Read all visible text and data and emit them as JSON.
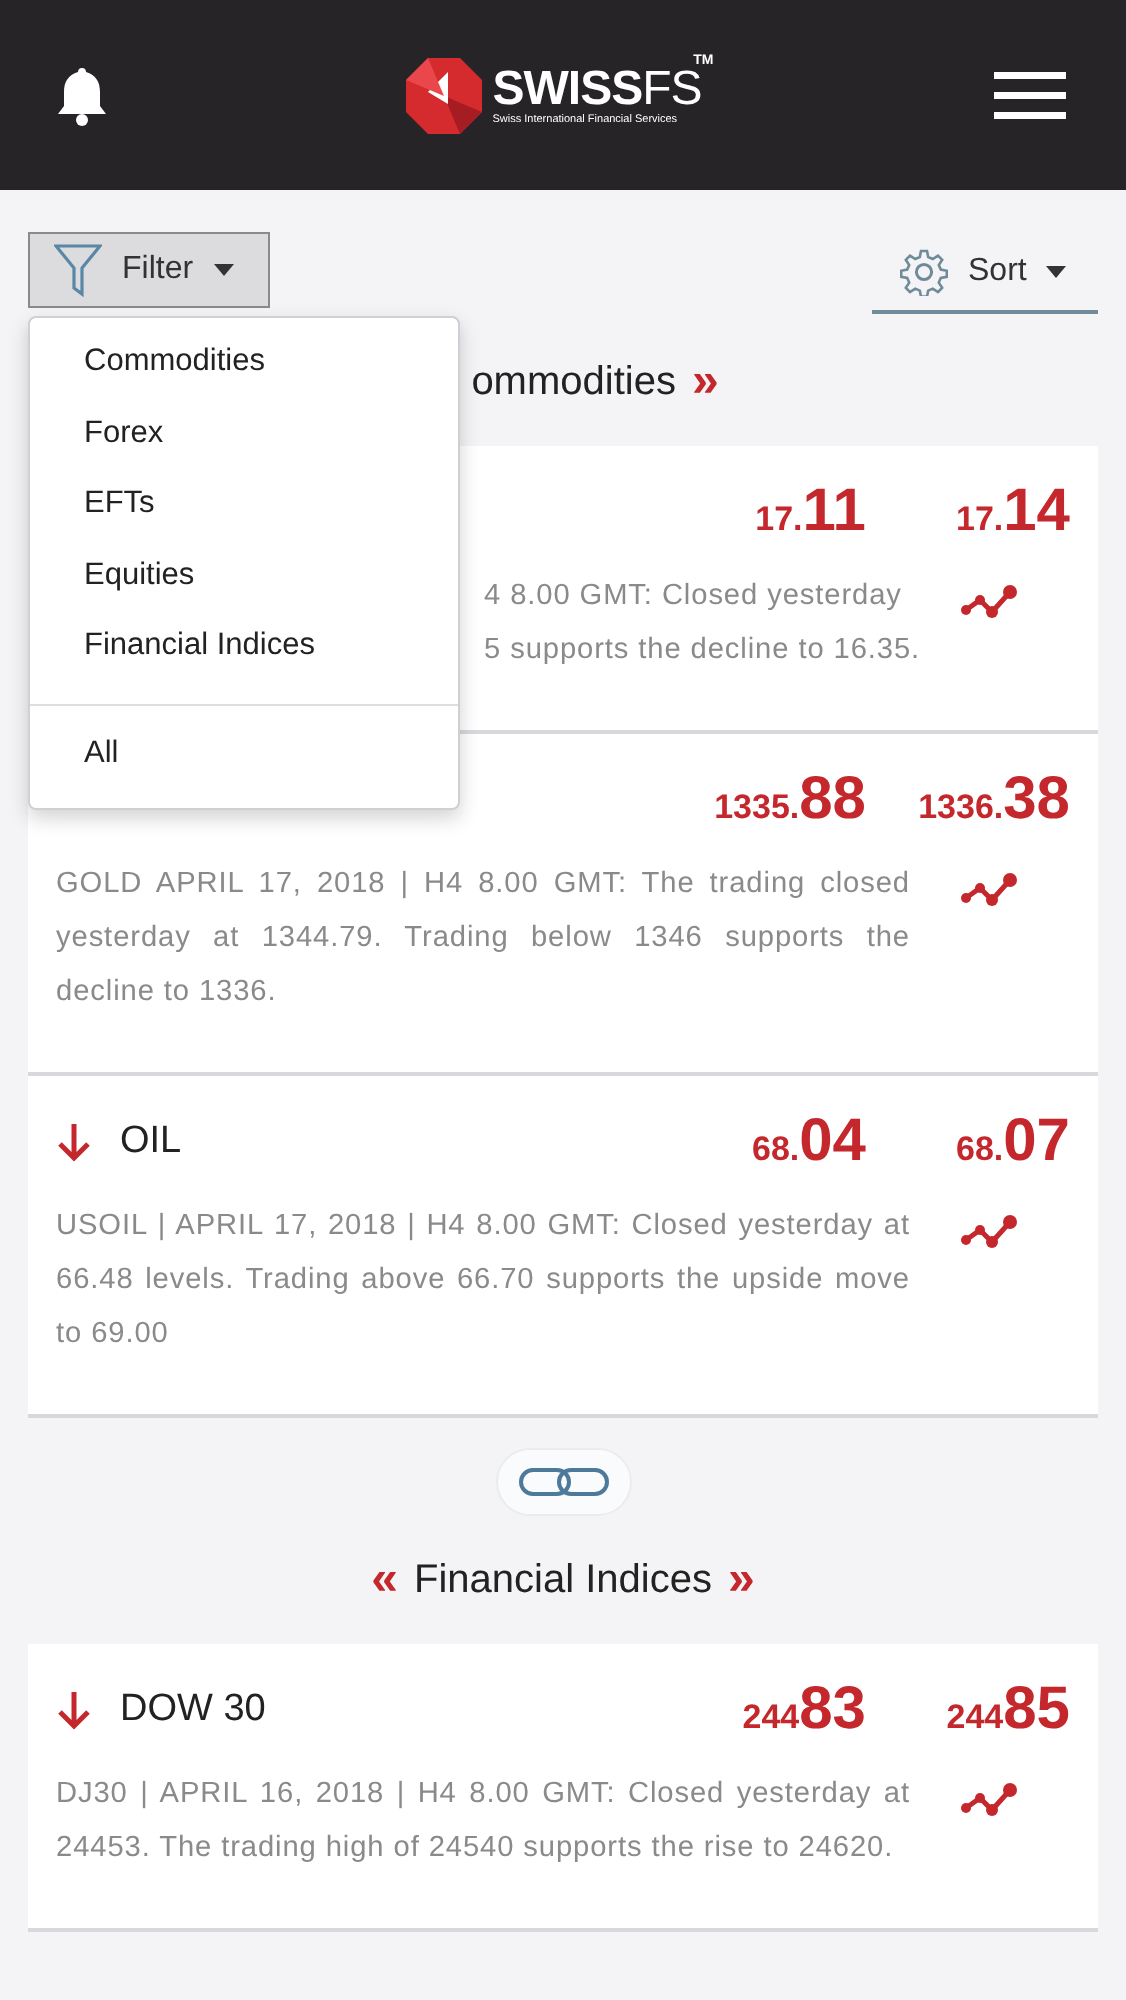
{
  "header": {
    "logo_text": "SWISS",
    "logo_text_2": "FS",
    "logo_tm": "TM",
    "logo_tagline": "Swiss International Financial Services"
  },
  "filter": {
    "label": "Filter",
    "expanded": true,
    "menu_groups": [
      [
        "Commodities",
        "Forex",
        "EFTs",
        "Equities",
        "Financial Indices"
      ],
      [
        "All"
      ]
    ]
  },
  "sort": {
    "label": "Sort"
  },
  "sections": [
    {
      "title": "ommodities",
      "right_marker": "»",
      "cards": [
        {
          "kind": "covered",
          "bid": {
            "int": "17.",
            "dec": "11"
          },
          "ask": {
            "int": "17.",
            "dec": "14"
          },
          "description_lines": [
            "4 8.00 GMT: Closed yesterday",
            "5 supports the decline to 16.35."
          ]
        },
        {
          "kind": "full",
          "bid": {
            "int": "1335.",
            "dec": "88"
          },
          "ask": {
            "int": "1336.",
            "dec": "38"
          },
          "description": "GOLD APRIL 17, 2018 | H4 8.00 GMT: The trading closed yesterday at 1344.79. Trading below 1346 supports the decline to 1336."
        },
        {
          "kind": "full",
          "falling": true,
          "name": "OIL",
          "bid": {
            "int": "68.",
            "dec": "04"
          },
          "ask": {
            "int": "68.",
            "dec": "07"
          },
          "description": "USOIL | APRIL 17, 2018 | H4 8.00 GMT: Closed yesterday at 66.48 levels. Trading above 66.70 supports the upside move to 69.00"
        }
      ]
    },
    {
      "title": "Financial Indices",
      "left_marker": "«",
      "right_marker": "»",
      "cards": [
        {
          "kind": "full",
          "falling": true,
          "name": "DOW 30",
          "bid": {
            "int": "244",
            "dec": "83"
          },
          "ask": {
            "int": "244",
            "dec": "85"
          },
          "description": "DJ30 | APRIL 16, 2018 | H4 8.00 GMT: Closed yesterday at 24453. The trading high of 24540 supports the rise to 24620."
        }
      ]
    }
  ]
}
